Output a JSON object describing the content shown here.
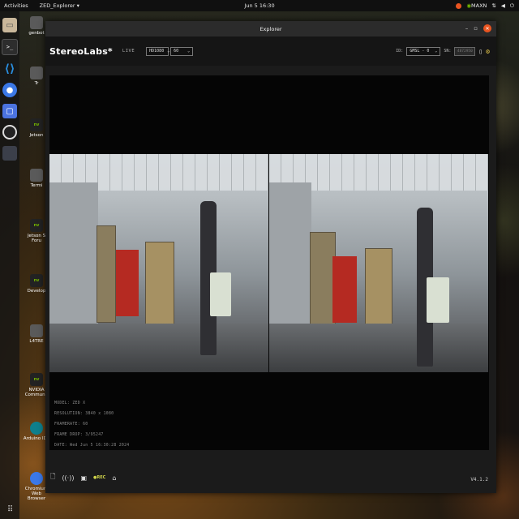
{
  "topbar": {
    "activities": "Activities",
    "app_name": "ZED_Explorer ▾",
    "clock": "Jun 5  16:30",
    "status_label": "MAXN"
  },
  "desktop": {
    "icons": [
      {
        "label": "genbot"
      },
      {
        "label": "Tr"
      },
      {
        "label": "Jetson"
      },
      {
        "label": "Termi"
      },
      {
        "label": "Jetson S Foru"
      },
      {
        "label": "Develop"
      },
      {
        "label": "L4TRE"
      },
      {
        "label": "NVIDIA Communit"
      },
      {
        "label": "Arduino IDE"
      },
      {
        "label": "Chromium Web Browser"
      }
    ]
  },
  "window": {
    "title": "Explorer",
    "logo": "StereoLabs*",
    "mode": "LIVE",
    "resolution_select": "HD1080",
    "fps_select": "60",
    "id_label": "ID:",
    "id_select": "GMSL - 0",
    "sn_label": "SN:",
    "sn_value": "4872950",
    "info": {
      "model": "MODEL: ZED X",
      "resolution": "RESOLUTION: 3840 x 1080",
      "framerate": "FRAMERATE: 60",
      "frame_drop": "FRAME DROP: 3/95247",
      "date": "DATE: Wed Jun 5 16:30:28 2024"
    },
    "version": "V4.1.2"
  },
  "colors": {
    "accent": "#e95420",
    "nvidia": "#76b900",
    "gear": "#e8c94a"
  }
}
